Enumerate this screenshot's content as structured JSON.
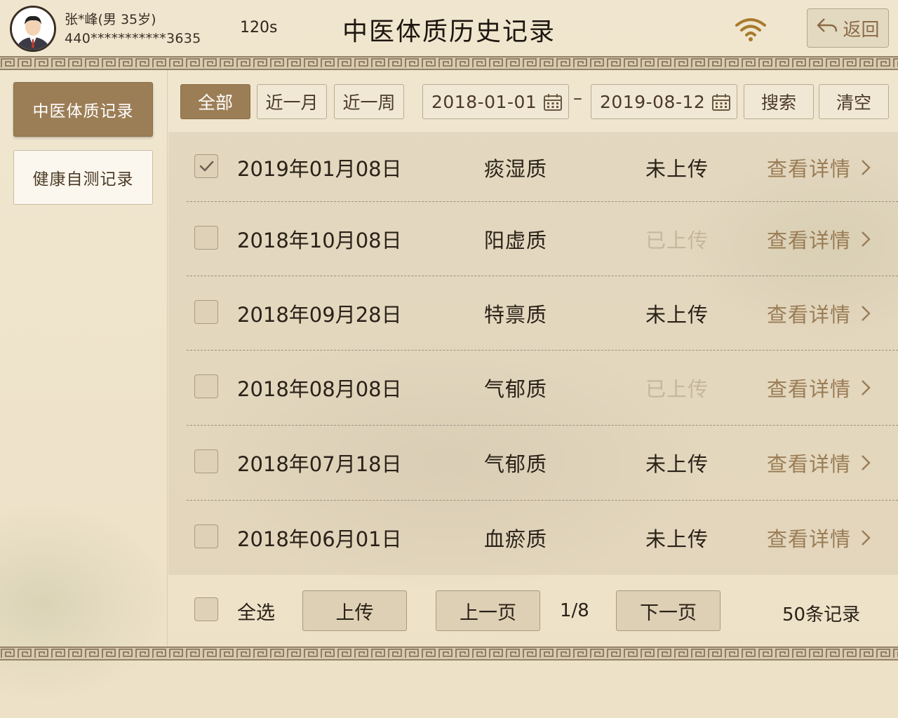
{
  "header": {
    "user_name": "张*峰(男 35岁)",
    "user_id": "440***********3635",
    "countdown": "120s",
    "title": "中医体质历史记录",
    "back_label": "返回"
  },
  "sidebar": {
    "items": [
      {
        "label": "中医体质记录",
        "active": true
      },
      {
        "label": "健康自测记录",
        "active": false
      }
    ]
  },
  "filters": {
    "ranges": [
      "全部",
      "近一月",
      "近一周"
    ],
    "active_range": "全部",
    "start_date": "2018-01-01",
    "end_date": "2019-08-12",
    "separator": "–",
    "search_label": "搜索",
    "clear_label": "清空"
  },
  "records": [
    {
      "date": "2019年01月08日",
      "constitution": "痰湿质",
      "status": "未上传",
      "uploaded": false,
      "checked": true,
      "detail": "查看详情"
    },
    {
      "date": "2018年10月08日",
      "constitution": "阳虚质",
      "status": "已上传",
      "uploaded": true,
      "checked": false,
      "detail": "查看详情"
    },
    {
      "date": "2018年09月28日",
      "constitution": "特禀质",
      "status": "未上传",
      "uploaded": false,
      "checked": false,
      "detail": "查看详情"
    },
    {
      "date": "2018年08月08日",
      "constitution": "气郁质",
      "status": "已上传",
      "uploaded": true,
      "checked": false,
      "detail": "查看详情"
    },
    {
      "date": "2018年07月18日",
      "constitution": "气郁质",
      "status": "未上传",
      "uploaded": false,
      "checked": false,
      "detail": "查看详情"
    },
    {
      "date": "2018年06月01日",
      "constitution": "血瘀质",
      "status": "未上传",
      "uploaded": false,
      "checked": false,
      "detail": "查看详情"
    }
  ],
  "footer": {
    "select_all_label": "全选",
    "upload_label": "上传",
    "prev_label": "上一页",
    "page_indicator": "1/8",
    "next_label": "下一页",
    "total_label": "50条记录"
  },
  "colors": {
    "accent": "#9c7e56",
    "detail_link": "#9a7c55",
    "uploaded_status": "#c4b79e",
    "background": "#efe4cc"
  },
  "icons": {
    "avatar": "user-avatar",
    "wifi": "wifi-icon",
    "back": "back-arrow-icon",
    "calendar": "calendar-icon",
    "chevron": "chevron-right-icon",
    "check": "check-icon"
  }
}
